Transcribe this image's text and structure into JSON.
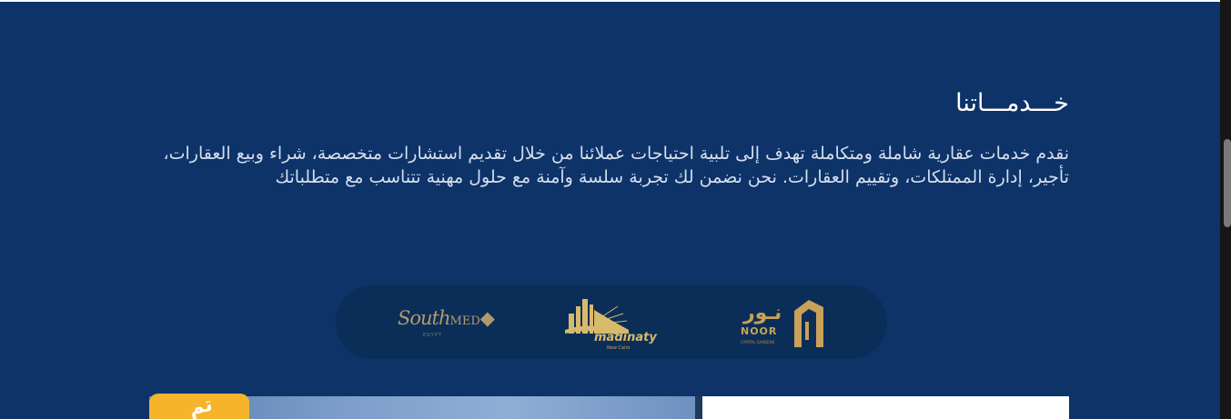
{
  "services": {
    "title": "خـــدمـــاتنا",
    "description": "نقدم خدمات عقارية شاملة ومتكاملة تهدف إلى تلبية احتياجات عملائنا من خلال تقديم استشارات متخصصة، شراء وبيع العقارات، تأجير، إدارة الممتلكات، وتقييم العقارات. نحن نضمن لك تجربة سلسة وآمنة مع حلول مهنية تتناسب مع متطلباتك"
  },
  "partners": {
    "southmed": {
      "wordmark": "South",
      "wordmark_suffix": "MED",
      "sub": "EGYPT",
      "icon": "southmed-logo"
    },
    "madinaty": {
      "wordmark": "madinaty",
      "sub": "New Cairo",
      "icon": "madinaty-sunrise-logo"
    },
    "noor": {
      "wordmark_ar": "نـور",
      "wordmark_en": "NOOR",
      "sub": "CAPITAL GARDENS",
      "icon": "noor-arch-logo"
    }
  },
  "card": {
    "badge": "تم"
  },
  "colors": {
    "background": "#0d3369",
    "pill": "#0b2e58",
    "gold": "#c9a159",
    "badge": "#f6b42a"
  }
}
